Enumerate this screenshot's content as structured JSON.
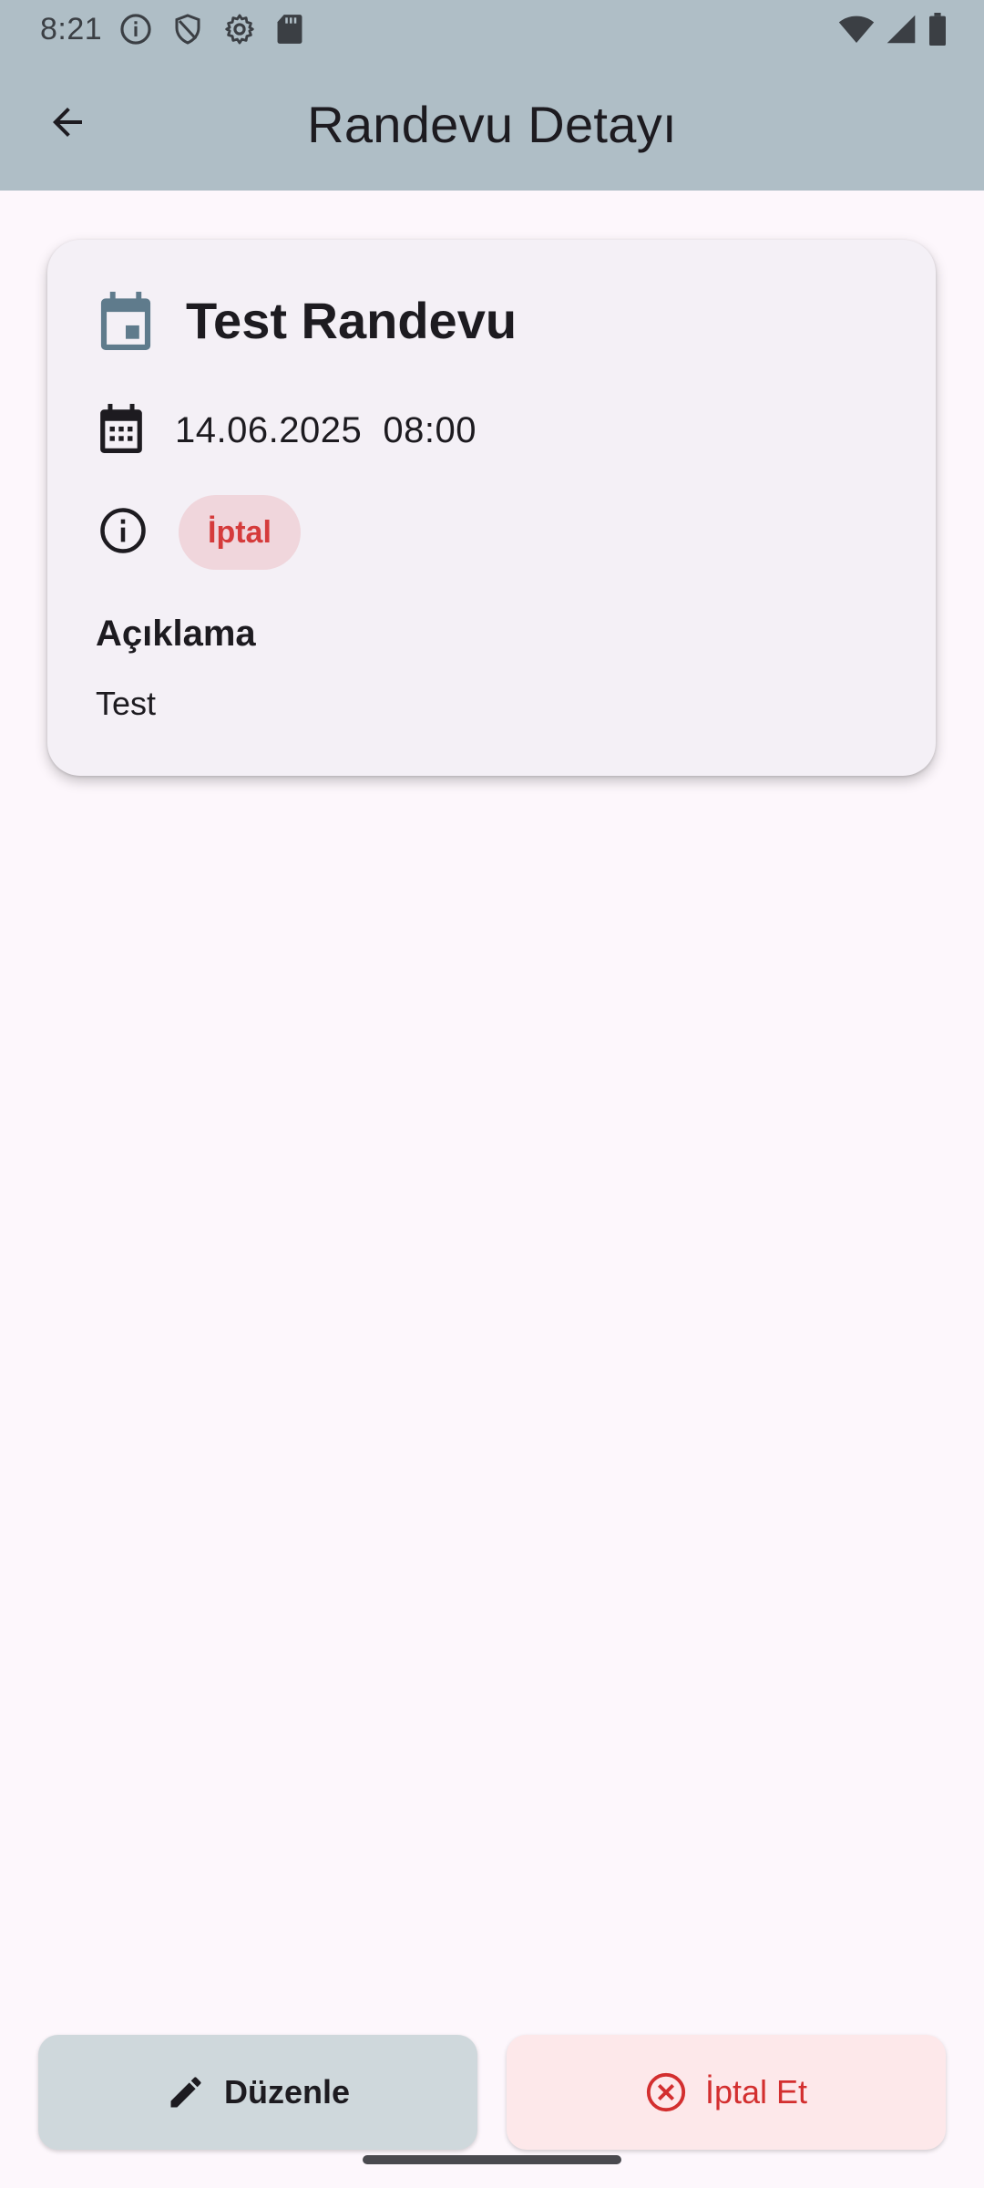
{
  "status_bar": {
    "time": "8:21",
    "left_icons": [
      "info-icon",
      "shield-icon",
      "gear-icon",
      "sd-card-icon"
    ],
    "right_icons": [
      "wifi-icon",
      "signal-icon",
      "battery-icon"
    ]
  },
  "app_bar": {
    "back_icon": "arrow-back-icon",
    "title": "Randevu Detayı"
  },
  "appointment": {
    "title": "Test Randevu",
    "date": "14.06.2025",
    "time": "08:00",
    "datetime_display": "14.06.2025  08:00",
    "status": "İptal",
    "description_heading": "Açıklama",
    "description": "Test"
  },
  "actions": {
    "edit_label": "Düzenle",
    "cancel_label": "İptal Et"
  },
  "colors": {
    "header": "#afbec6",
    "background": "#fdf7fc",
    "card": "#f4f0f6",
    "chip_bg": "#f0d6dc",
    "danger": "#d32f2f",
    "edit_button": "#cfd8dc",
    "cancel_button": "#fde8ea"
  }
}
